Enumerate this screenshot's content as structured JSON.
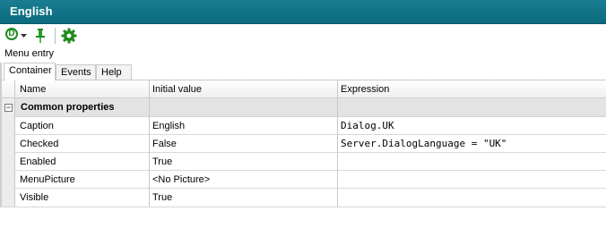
{
  "window": {
    "title": "English"
  },
  "toolbar": {
    "dialog_badge": "D",
    "dropdown_icon": "chevron-down-icon",
    "pin_icon": "pin-icon",
    "settings_icon": "gear-icon",
    "accent_color": "#1f8a1f"
  },
  "section_label": "Menu entry",
  "tabs": [
    {
      "label": "Container",
      "active": true
    },
    {
      "label": "Events",
      "active": false
    },
    {
      "label": "Help",
      "active": false
    }
  ],
  "grid": {
    "columns": [
      "Name",
      "Initial value",
      "Expression"
    ],
    "group": {
      "label": "Common properties",
      "toggle": "−"
    },
    "rows": [
      {
        "name": "Caption",
        "value": "English",
        "expression": "Dialog.UK"
      },
      {
        "name": "Checked",
        "value": "False",
        "expression": "Server.DialogLanguage = \"UK\""
      },
      {
        "name": "Enabled",
        "value": "True",
        "expression": ""
      },
      {
        "name": "MenuPicture",
        "value": "<No Picture>",
        "expression": ""
      },
      {
        "name": "Visible",
        "value": "True",
        "expression": ""
      }
    ]
  },
  "colors": {
    "title_bar": "#0c6a7e",
    "group_bg": "#e3e3e3"
  }
}
